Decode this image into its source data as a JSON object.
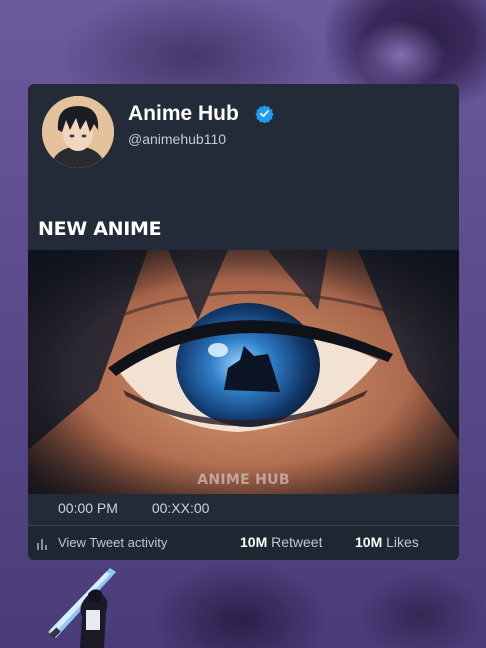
{
  "profile": {
    "name": "Anime Hub",
    "handle": "@animehub110",
    "verified": true
  },
  "post": {
    "text": "NEW ANIME",
    "media_watermark": "ANIME HUB",
    "time": "00:00 PM",
    "date": "00:XX:00"
  },
  "stats": {
    "activity_label": "View Tweet activity",
    "retweet_count": "10M",
    "retweet_label": "Retweet",
    "likes_count": "10M",
    "likes_label": "Likes"
  },
  "colors": {
    "background": "#5d4d8f",
    "card": "#222b37",
    "verified_badge": "#1d9bf0",
    "eye_iris": "#2f7fc8"
  },
  "icons": [
    "verified-badge-icon",
    "bar-chart-icon"
  ]
}
